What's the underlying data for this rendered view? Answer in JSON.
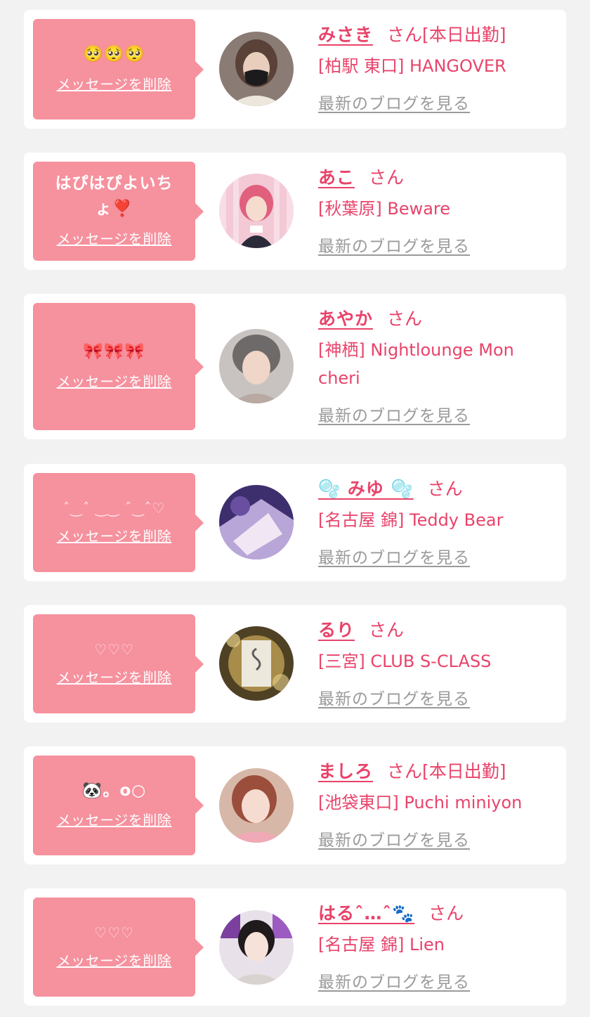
{
  "common": {
    "delete_label": "メッセージを削除",
    "blog_label": "最新のブログを見る",
    "honorific": "さん",
    "bubble_color": "#f6919e",
    "accent_color": "#e8436a",
    "link_gray": "#9a9a9a"
  },
  "cards": [
    {
      "message": "🥺🥺🥺",
      "name": "みさき",
      "tag": "[本日出勤]",
      "shop": "[柏駅 東口] HANGOVER"
    },
    {
      "message": "はぴはぴよいちょ❣️",
      "name": "あこ",
      "tag": "",
      "shop": "[秋葉原] Beware"
    },
    {
      "message": "🎀🎀🎀",
      "name": "あやか",
      "tag": "",
      "shop": "[神栖] Nightlounge Mon cheri"
    },
    {
      "message": "ˆ‿ˆ ‿‿ ˆ‿ˆ♡",
      "name": "🫧 みゆ 🫧",
      "tag": "",
      "shop": "[名古屋 錦] Teddy Bear"
    },
    {
      "message": "♡♡♡",
      "name": "るり",
      "tag": "",
      "shop": "[三宮] CLUB S-CLASS"
    },
    {
      "message": "🐼。o○",
      "name": "ましろ",
      "tag": "[本日出勤]",
      "shop": "[池袋東口] Puchi miniyon"
    },
    {
      "message": "♡♡♡",
      "name": "はるˆ…ˆ🐾",
      "tag": "",
      "shop": "[名古屋 錦] Lien"
    }
  ]
}
